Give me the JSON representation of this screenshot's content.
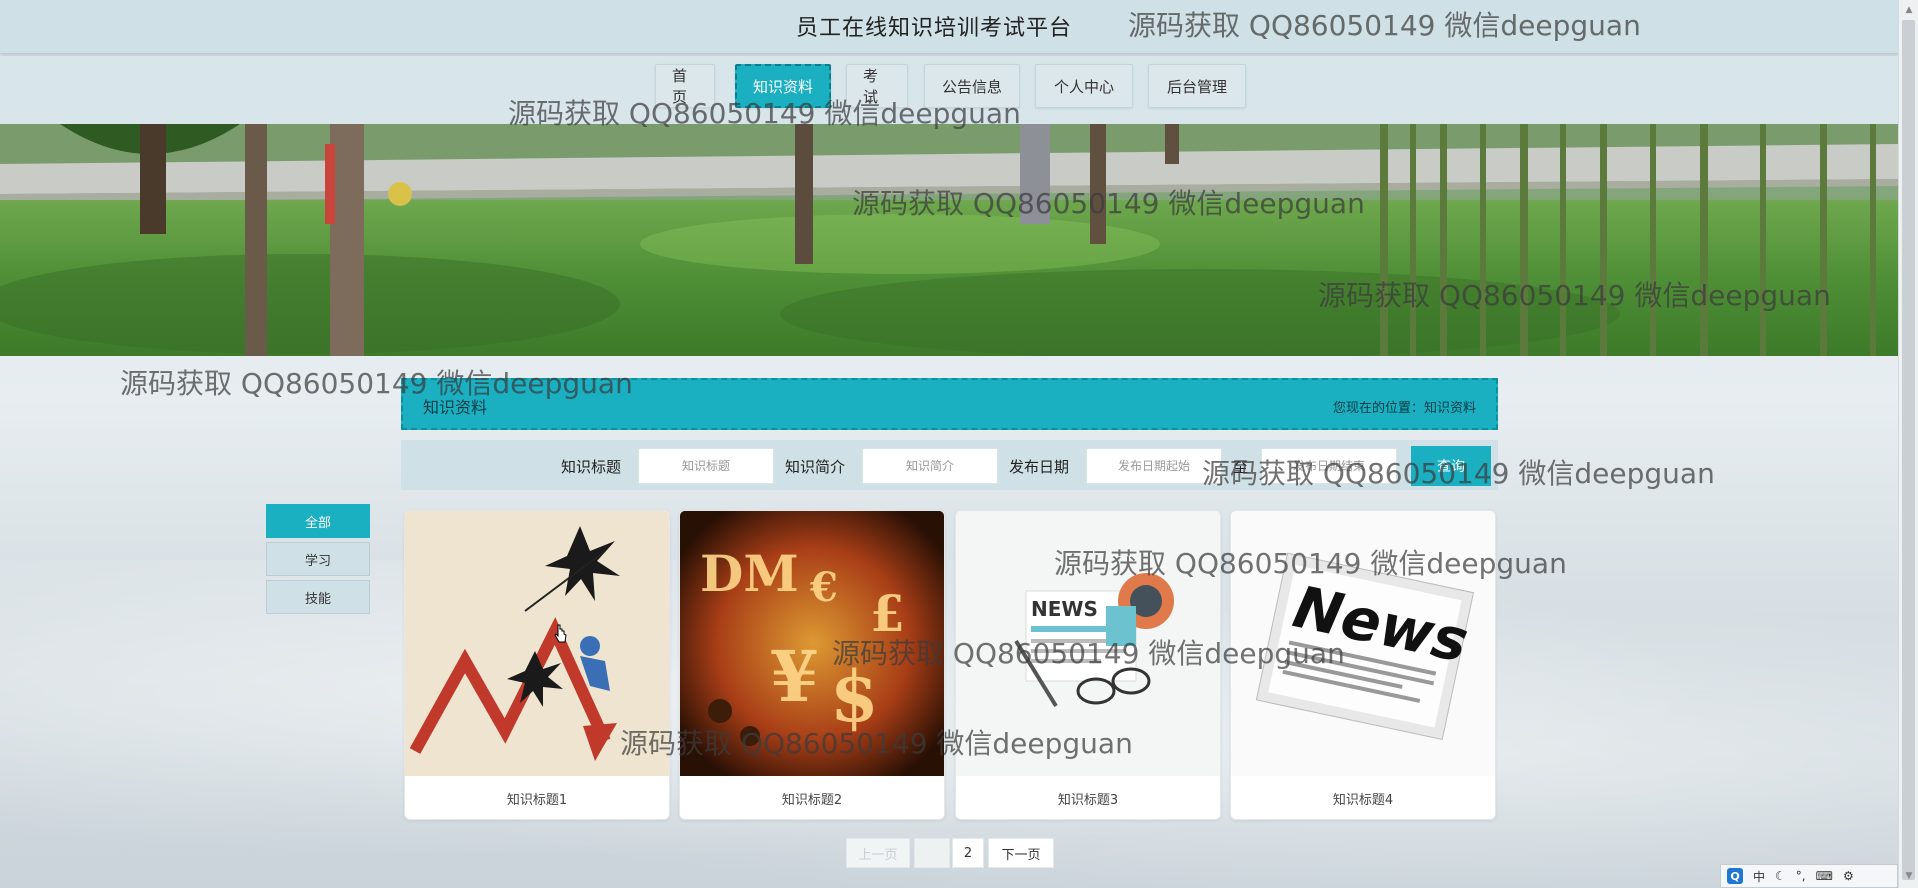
{
  "site": {
    "title": "员工在线知识培训考试平台"
  },
  "nav": {
    "items": [
      "首页",
      "知识资料",
      "考试",
      "公告信息",
      "个人中心",
      "后台管理"
    ],
    "active_index": 1
  },
  "section": {
    "title": "知识资料",
    "breadcrumb": "您现在的位置：知识资料"
  },
  "search": {
    "title_label": "知识标题",
    "title_placeholder": "知识标题",
    "intro_label": "知识简介",
    "intro_placeholder": "知识简介",
    "date_label": "发布日期",
    "date_start_placeholder": "发布日期起始",
    "date_to_label": "至",
    "date_end_placeholder": "发布日期结束",
    "button_label": "查询"
  },
  "categories": [
    "全部",
    "学习",
    "技能"
  ],
  "active_category_index": 0,
  "cards": [
    {
      "title": "知识标题1",
      "image_icon": "stock-crash-illustration"
    },
    {
      "title": "知识标题2",
      "image_icon": "currency-symbols-fire"
    },
    {
      "title": "知识标题3",
      "image_icon": "news-flat-illustration"
    },
    {
      "title": "知识标题4",
      "image_icon": "newspaper-news"
    }
  ],
  "pagination": {
    "prev": "上一页",
    "current": "1",
    "next_page": "2",
    "next": "下一页"
  },
  "watermark": "源码获取 QQ86050149 微信deepguan",
  "ime": {
    "mode": "中"
  },
  "colors": {
    "accent": "#1aafc1",
    "header_bg": "#cfe0e6"
  }
}
